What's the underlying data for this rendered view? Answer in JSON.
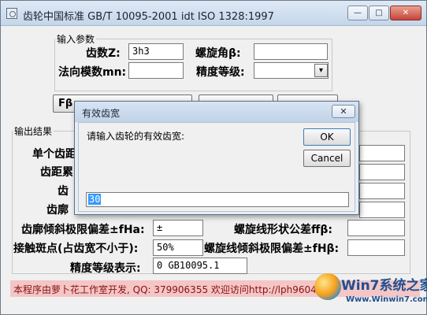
{
  "window": {
    "title": "齿轮中国标准  GB/T 10095-2001 idt ISO 1328:1997",
    "minimize_glyph": "—",
    "maximize_glyph": "□",
    "close_glyph": "✕"
  },
  "input_group": {
    "legend": "输入参数",
    "teeth_label": "齿数Z:",
    "teeth_value": "3h3",
    "helix_label": "螺旋角β:",
    "helix_value": "",
    "module_label": "法向模数mn:",
    "module_value": "",
    "grade_label": "精度等级:",
    "grade_value": "",
    "dropdown_glyph": "▾"
  },
  "buttons_row": {
    "fb_label": "Fβ"
  },
  "output_group": {
    "legend": "输出结果",
    "label1": "单个齿距",
    "label2": "齿距累",
    "label3": "齿",
    "label4": "齿廓",
    "profile_slope_label": "齿廓倾斜极限偏差±fHa:",
    "profile_slope_value": "±",
    "helix_form_label": "螺旋线形状公差ffβ:",
    "helix_form_value": "",
    "contact_label": "接触斑点(占齿宽不小于):",
    "contact_value": "50%",
    "helix_slope_label": "螺旋线倾斜极限偏差±fHβ:",
    "helix_slope_value": "",
    "grade_display_label": "精度等级表示:",
    "grade_display_value": "0  GB10095.1"
  },
  "footer": {
    "text": "本程序由萝卜花工作室开发, QQ: 379906355 欢迎访问http://lph9604tp.h"
  },
  "watermark": {
    "brand": "Win7系统之家",
    "url": "Www.Winwin7.com"
  },
  "dialog": {
    "title": "有效齿宽",
    "close_glyph": "✕",
    "prompt": "请输入齿轮的有效齿宽:",
    "ok_label": "OK",
    "cancel_label": "Cancel",
    "input_value": "30"
  }
}
